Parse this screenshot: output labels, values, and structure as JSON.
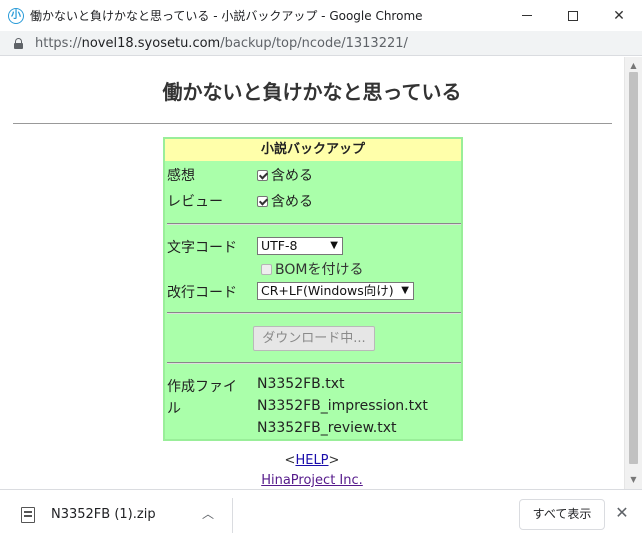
{
  "window": {
    "title": "働かないと負けかなと思っている - 小説バックアップ - Google Chrome",
    "app_icon_glyph": "小"
  },
  "address_bar": {
    "scheme": "https://",
    "host": "novel18.syosetu.com",
    "path": "/backup/top/ncode/1313221/"
  },
  "page": {
    "title": "働かないと負けかなと思っている",
    "panel": {
      "header": "小説バックアップ",
      "impressions": {
        "label": "感想",
        "option": "含める",
        "checked": true
      },
      "reviews": {
        "label": "レビュー",
        "option": "含める",
        "checked": true
      },
      "encoding": {
        "label": "文字コード",
        "selected": "UTF-8",
        "bom_label": "BOMを付ける",
        "bom_checked": false
      },
      "newline": {
        "label": "改行コード",
        "selected": "CR+LF(Windows向け)"
      },
      "download_button": "ダウンロード中...",
      "files": {
        "label_line1": "作成ファイ",
        "label_line2": "ル",
        "items": [
          "N3352FB.txt",
          "N3352FB_impression.txt",
          "N3352FB_review.txt"
        ]
      }
    },
    "help": {
      "prefix": "<",
      "link": "HELP",
      "suffix": ">"
    },
    "company_link": "HinaProject Inc."
  },
  "download_bar": {
    "file_name": "N3352FB (1).zip",
    "show_all": "すべて表示"
  },
  "colors": {
    "panel_bg": "#aaffaa",
    "panel_header_bg": "#ffffaa",
    "link": "#1a0dab"
  }
}
